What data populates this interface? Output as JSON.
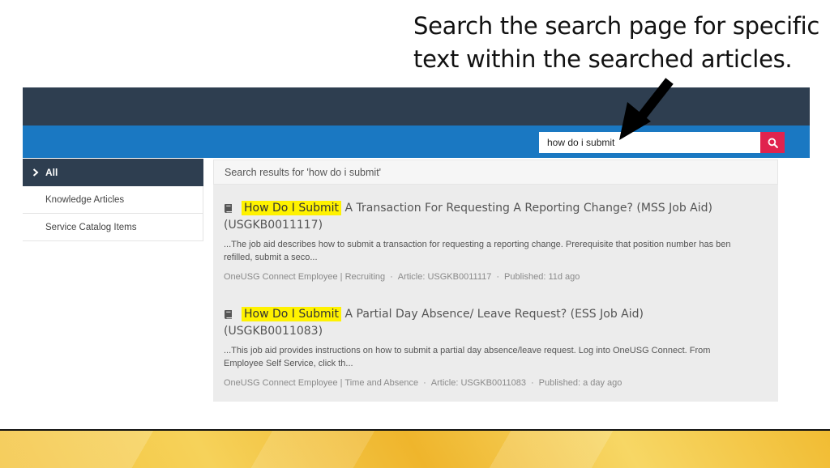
{
  "callout": {
    "line1": "Search the search page for specific",
    "line2": "text within the searched articles."
  },
  "search": {
    "value": "how do i submit",
    "button_icon": "search-icon",
    "accent_color": "#e0234e"
  },
  "sidebar": {
    "items": [
      {
        "label": "All",
        "active": true
      },
      {
        "label": "Knowledge Articles"
      },
      {
        "label": "Service Catalog Items"
      }
    ]
  },
  "results": {
    "header": "Search results for 'how do i submit'",
    "items": [
      {
        "highlight": "How Do I Submit",
        "title_rest": " A Transaction For Requesting A Reporting Change? (MSS Job Aid)",
        "title_line2": "(USGKB0011117)",
        "snippet_line1": "...The job aid describes how to submit a transaction for requesting a reporting change. Prerequisite that position number has ben",
        "snippet_line2": "refilled, submit a seco...",
        "meta_source": "OneUSG Connect Employee | Recruiting",
        "meta_article": "Article: USGKB0011117",
        "meta_published": "Published: 11d ago"
      },
      {
        "highlight": "How Do I Submit",
        "title_rest": " A Partial Day Absence/ Leave Request? (ESS Job Aid)",
        "title_line2": "(USGKB0011083)",
        "snippet_line1": "...This job aid provides instructions on how to submit a partial day absence/leave request. Log into OneUSG Connect. From",
        "snippet_line2": "Employee Self Service, click th...",
        "meta_source": "OneUSG Connect Employee | Time and Absence",
        "meta_article": "Article: USGKB0011083",
        "meta_published": "Published: a day ago"
      }
    ]
  },
  "colors": {
    "topbar": "#2e3e50",
    "bluebar": "#1a78c2",
    "highlight": "#fff200"
  }
}
